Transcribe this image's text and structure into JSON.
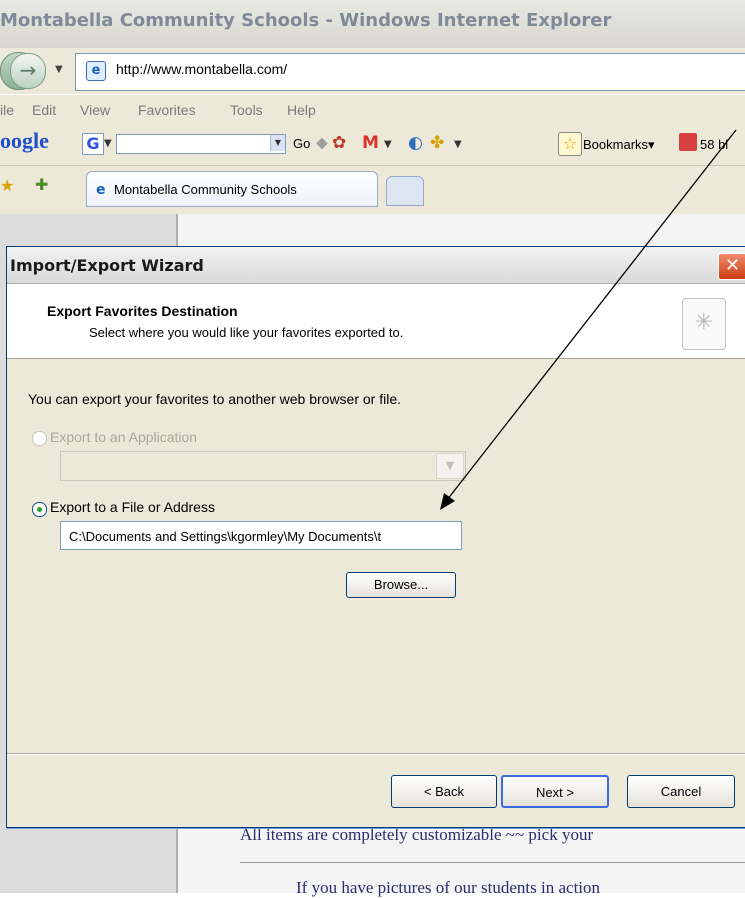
{
  "browser": {
    "title": "Montabella Community Schools - Windows Internet Explorer",
    "url": "http://www.montabella.com/",
    "menu": [
      "ile",
      "Edit",
      "View",
      "Favorites",
      "Tools",
      "Help"
    ],
    "google_label": "oogle",
    "google_button": "G",
    "go_label": "Go",
    "bookmarks_label": "Bookmarks",
    "blocked_label": "58 bl",
    "tab_label": "Montabella Community Schools",
    "icons": [
      "back-forward-icon",
      "ie-page-icon",
      "gmail-icon",
      "bookmark-star-icon",
      "popup-blocked-icon",
      "favorites-star-icon",
      "add-favorites-icon"
    ]
  },
  "dialog": {
    "title": "Import/Export Wizard",
    "header_title": "Export Favorites Destination",
    "header_subtitle": "Select where you would like your favorites exported to.",
    "intro": "You can export your favorites to another web browser or file.",
    "option_app_label": "Export to an Application",
    "option_app_enabled": false,
    "option_file_label": "Export to a File or Address",
    "option_file_selected": true,
    "path_value": "C:\\Documents and Settings\\kgormley\\My Documents\\t",
    "browse_label": "Browse...",
    "back_label": "< Back",
    "next_label": "Next >",
    "cancel_label": "Cancel",
    "close_symbol": "✕"
  },
  "page": {
    "text1": "All items are completely customizable ~~ pick your",
    "text2": "If you have pictures of our students in action"
  },
  "colors": {
    "dialog_bg": "#ece9d8",
    "page_text": "#2c2d6b",
    "close_red": "#cc3d15"
  }
}
